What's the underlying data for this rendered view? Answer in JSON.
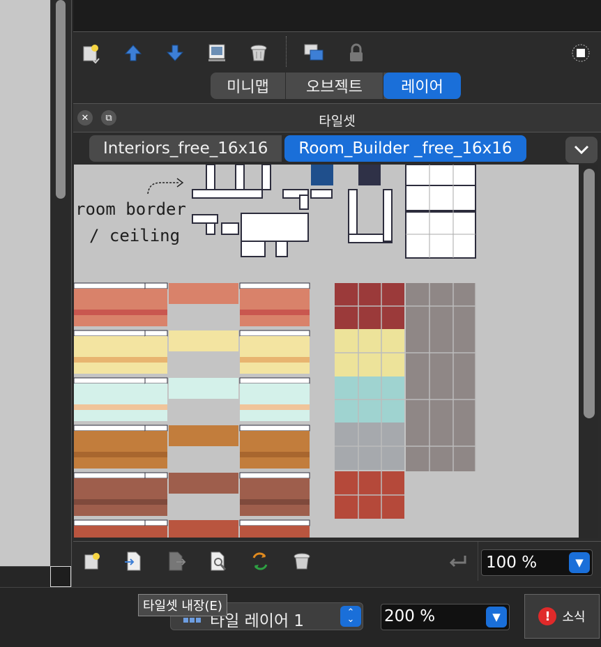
{
  "window": {
    "tooltip": "타일셋 내장(E)"
  },
  "layers_toolbar": {
    "icons": [
      "new-layer-icon",
      "move-up-icon",
      "move-down-icon",
      "duplicate-icon",
      "delete-icon",
      "merge-icon",
      "lock-icon",
      "highlight-icon"
    ]
  },
  "top_tabs": {
    "items": [
      {
        "label": "미니맵"
      },
      {
        "label": "오브젝트"
      },
      {
        "label": "레이어"
      }
    ],
    "selected": "레이어"
  },
  "tileset_panel": {
    "title": "타일셋",
    "tabs": [
      {
        "label": "Interiors_free_16x16"
      },
      {
        "label": "Room_Builder _free_16x16"
      }
    ],
    "selected_tab": "Room_Builder _free_16x16",
    "canvas_text": {
      "line1": "room border",
      "line2": "/ ceiling"
    },
    "zoom": "100 %"
  },
  "tileset_toolbar": {
    "icons": [
      "new-tileset-icon",
      "embed-tileset-icon",
      "export-tileset-icon",
      "edit-tileset-icon",
      "replace-tileset-icon",
      "delete-tileset-icon",
      "undo-icon"
    ]
  },
  "status_bar": {
    "layer_select": "타일 레이어 1",
    "zoom": "200 %",
    "news_label": "소식",
    "news_icon": "!"
  },
  "colors": {
    "accent": "#1a6fd9",
    "canvas_bg": "#c4c4c4",
    "alert": "#e02a2a"
  }
}
